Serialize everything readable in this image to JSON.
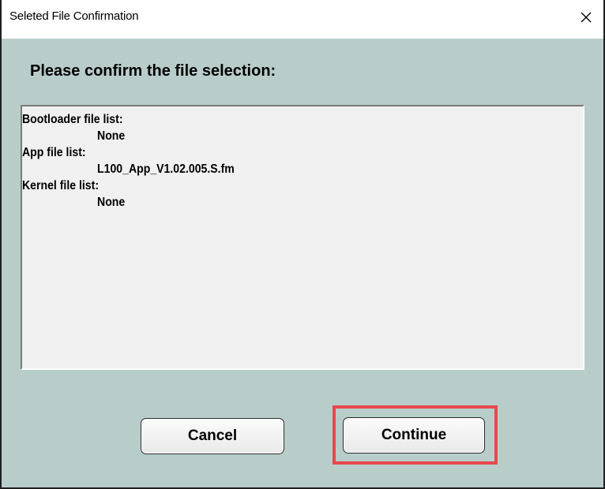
{
  "window": {
    "title": "Seleted File Confirmation"
  },
  "icons": {
    "close": "close-icon"
  },
  "dialog": {
    "heading": "Please confirm the file selection:",
    "file_list": [
      {
        "kind": "header",
        "text": "Bootloader file list:"
      },
      {
        "kind": "item",
        "text": "None"
      },
      {
        "kind": "header",
        "text": "App file list:"
      },
      {
        "kind": "item",
        "text": "L100_App_V1.02.005.S.fm"
      },
      {
        "kind": "header",
        "text": "Kernel file list:"
      },
      {
        "kind": "item",
        "text": "None"
      }
    ]
  },
  "buttons": {
    "cancel_label": "Cancel",
    "continue_label": "Continue"
  },
  "colors": {
    "dialog_background": "#b8cdc9",
    "list_background": "#f0f0f0",
    "highlight_border": "#e8484d"
  }
}
